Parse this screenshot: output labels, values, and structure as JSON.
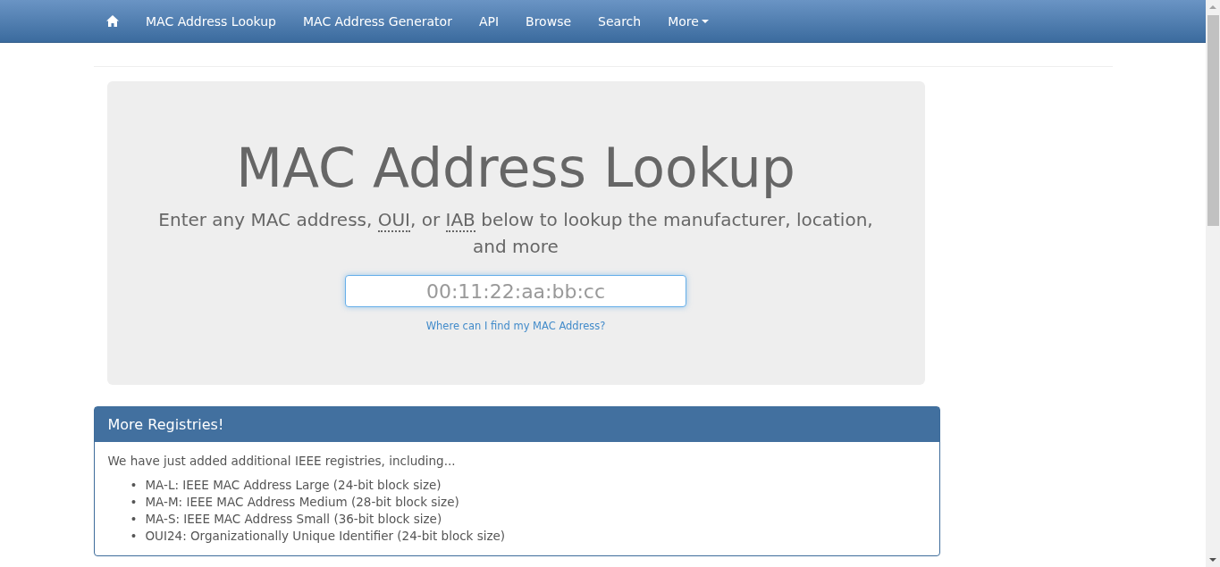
{
  "navbar": {
    "items": [
      {
        "kind": "home"
      },
      {
        "kind": "link",
        "label": "MAC Address Lookup"
      },
      {
        "kind": "link",
        "label": "MAC Address Generator"
      },
      {
        "kind": "link",
        "label": "API"
      },
      {
        "kind": "link",
        "label": "Browse"
      },
      {
        "kind": "link",
        "label": "Search"
      },
      {
        "kind": "dropdown",
        "label": "More"
      }
    ]
  },
  "hero": {
    "title": "MAC Address Lookup",
    "subtitle": [
      {
        "kind": "plain",
        "text": "Enter any MAC address, "
      },
      {
        "kind": "abbr",
        "text": "OUI"
      },
      {
        "kind": "plain",
        "text": ", or "
      },
      {
        "kind": "abbr",
        "text": "IAB"
      },
      {
        "kind": "plain",
        "text": " below to lookup the manufacturer, location, and more"
      }
    ],
    "search": {
      "placeholder": "00:11:22:aa:bb:cc"
    },
    "help_link": "Where can I find my MAC Address?"
  },
  "panel": {
    "title": "More Registries!",
    "intro": "We have just added additional IEEE registries, including...",
    "items": [
      {
        "bullet": "•",
        "text": "MA-L: IEEE MAC Address Large (24-bit block size)"
      },
      {
        "bullet": "•",
        "text": "MA-M: IEEE MAC Address Medium (28-bit block size)"
      },
      {
        "bullet": "•",
        "text": "MA-S: IEEE MAC Address Small (36-bit block size)"
      },
      {
        "bullet": "•",
        "text": "OUI24: Organizationally Unique Identifier (24-bit block size)"
      }
    ]
  }
}
